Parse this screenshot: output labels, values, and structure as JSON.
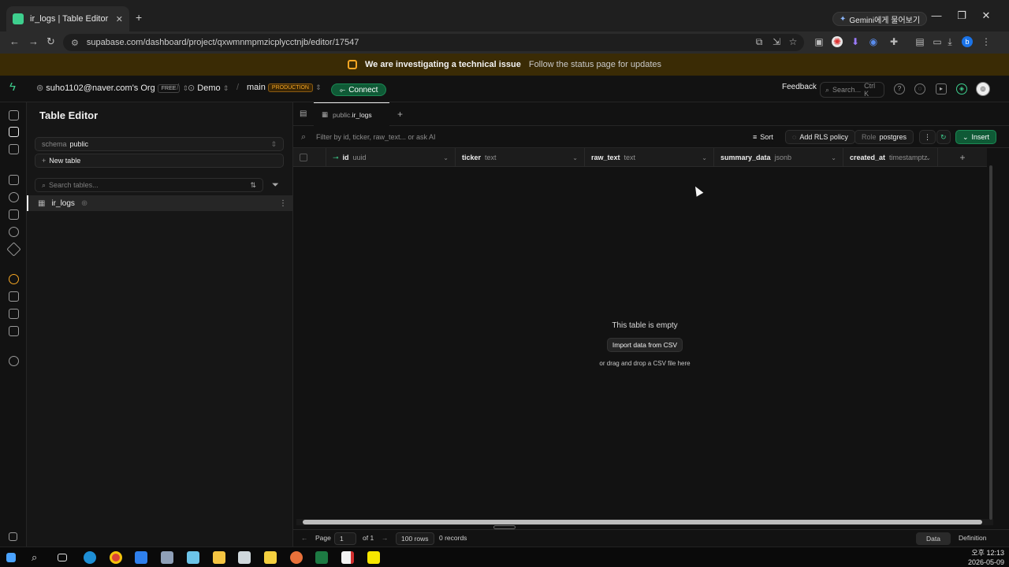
{
  "browser": {
    "tab_title": "ir_logs | Table Editor | Demo |",
    "url": "supabase.com/dashboard/project/qxwmnmpmzicplycctnjb/editor/17547",
    "gemini_label": "Gemini에게 물어보기"
  },
  "banner": {
    "title": "We are investigating a technical issue",
    "subtitle": "Follow the status page for updates"
  },
  "header": {
    "org": "suho1102@naver.com's Org",
    "org_plan": "FREE",
    "project": "Demo",
    "branch": "main",
    "branch_env": "PRODUCTION",
    "connect_label": "Connect",
    "feedback_label": "Feedback",
    "search_placeholder": "Search...",
    "search_shortcut": "Ctrl K"
  },
  "sidebar": {
    "title": "Table Editor",
    "schema_prefix": "schema",
    "schema_value": "public",
    "new_table_label": "New table",
    "search_placeholder": "Search tables...",
    "tables": [
      {
        "name": "ir_logs"
      }
    ]
  },
  "editor": {
    "tab_schema": "public.",
    "tab_table": "ir_logs",
    "filter_placeholder": "Filter by id, ticker, raw_text... or ask AI",
    "sort_label": "Sort",
    "rls_label": "Add RLS policy",
    "role_prefix": "Role",
    "role_value": "postgres",
    "insert_label": "Insert",
    "columns": [
      {
        "name": "id",
        "type": "uuid"
      },
      {
        "name": "ticker",
        "type": "text"
      },
      {
        "name": "raw_text",
        "type": "text"
      },
      {
        "name": "summary_data",
        "type": "jsonb"
      },
      {
        "name": "created_at",
        "type": "timestamptz"
      }
    ],
    "empty_title": "This table is empty",
    "import_label": "Import data from CSV",
    "drop_hint": "or drag and drop a CSV file here"
  },
  "footer": {
    "page_label": "Page",
    "page_value": "1",
    "of_label": "of 1",
    "rows_label": "100 rows",
    "records_label": "0 records",
    "data_tab": "Data",
    "definition_tab": "Definition"
  },
  "taskbar": {
    "time": "오후 12:13",
    "date": "2026-05-09"
  },
  "colors": {
    "accent": "#3ecf8e",
    "connect_bg": "#0f5a36",
    "banner_bg": "#3a2b05",
    "warning": "#f5a623"
  }
}
